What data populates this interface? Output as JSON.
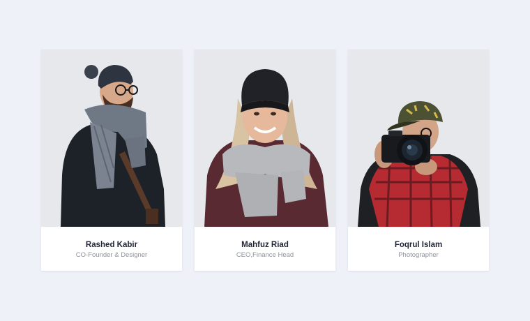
{
  "team": {
    "members": [
      {
        "name": "Rashed Kabir",
        "role": "CO-Founder & Designer"
      },
      {
        "name": "Mahfuz Riad",
        "role": "CEO,Finance Head"
      },
      {
        "name": "Foqrul Islam",
        "role": "Photographer"
      }
    ]
  },
  "colors": {
    "page_background": "#eef1f8",
    "photo_background": "#e7e8eb",
    "name_text": "#1f2436",
    "role_text": "#8e929c"
  }
}
